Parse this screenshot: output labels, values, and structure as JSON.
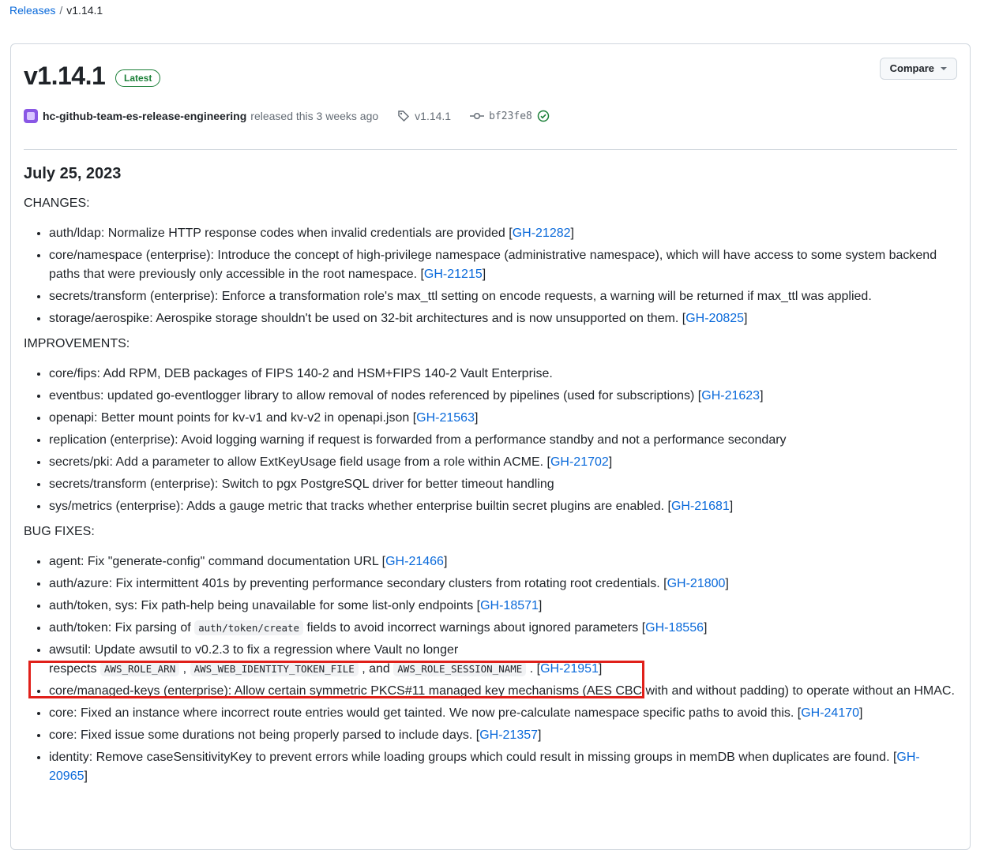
{
  "breadcrumb": {
    "root": "Releases",
    "sep": "/",
    "current": "v1.14.1"
  },
  "release": {
    "title": "v1.14.1",
    "badge": "Latest",
    "compare": "Compare",
    "author": "hc-github-team-es-release-engineering",
    "released": "released this 3 weeks ago",
    "tag": "v1.14.1",
    "commit": "bf23fe8"
  },
  "notes": {
    "date": "July 25, 2023",
    "changes_header": "CHANGES:",
    "changes": [
      {
        "text": "auth/ldap: Normalize HTTP response codes when invalid credentials are provided [",
        "link": "GH-21282",
        "after": "]"
      },
      {
        "text": "core/namespace (enterprise): Introduce the concept of high-privilege namespace (administrative namespace), which will have access to some system backend paths that were previously only accessible in the root namespace. [",
        "link": "GH-21215",
        "after": "]"
      },
      {
        "text": "secrets/transform (enterprise): Enforce a transformation role's max_ttl setting on encode requests, a warning will be returned if max_ttl was applied.",
        "link": "",
        "after": ""
      },
      {
        "text": "storage/aerospike: Aerospike storage shouldn't be used on 32-bit architectures and is now unsupported on them. [",
        "link": "GH-20825",
        "after": "]"
      }
    ],
    "improvements_header": "IMPROVEMENTS:",
    "improvements": [
      {
        "text": "core/fips: Add RPM, DEB packages of FIPS 140-2 and HSM+FIPS 140-2 Vault Enterprise.",
        "link": "",
        "after": ""
      },
      {
        "text": "eventbus: updated go-eventlogger library to allow removal of nodes referenced by pipelines (used for subscriptions) [",
        "link": "GH-21623",
        "after": "]"
      },
      {
        "text": "openapi: Better mount points for kv-v1 and kv-v2 in openapi.json [",
        "link": "GH-21563",
        "after": "]"
      },
      {
        "text": "replication (enterprise): Avoid logging warning if request is forwarded from a performance standby and not a performance secondary",
        "link": "",
        "after": ""
      },
      {
        "text": "secrets/pki: Add a parameter to allow ExtKeyUsage field usage from a role within ACME. [",
        "link": "GH-21702",
        "after": "]"
      },
      {
        "text": "secrets/transform (enterprise): Switch to pgx PostgreSQL driver for better timeout handling",
        "link": "",
        "after": ""
      },
      {
        "text": "sys/metrics (enterprise): Adds a gauge metric that tracks whether enterprise builtin secret plugins are enabled. [",
        "link": "GH-21681",
        "after": "]"
      }
    ],
    "bugfixes_header": "BUG FIXES:",
    "bugfixes": [
      {
        "text": "agent: Fix \"generate-config\" command documentation URL [",
        "link": "GH-21466",
        "after": "]"
      },
      {
        "text": "auth/azure: Fix intermittent 401s by preventing performance secondary clusters from rotating root credentials. [",
        "link": "GH-21800",
        "after": "]"
      },
      {
        "text": "auth/token, sys: Fix path-help being unavailable for some list-only endpoints [",
        "link": "GH-18571",
        "after": "]"
      }
    ],
    "bug_token_create": {
      "before": "auth/token: Fix parsing of ",
      "code": "auth/token/create",
      "middle": " fields to avoid incorrect warnings about ignored parameters [",
      "link": "GH-18556",
      "after": "]"
    },
    "bug_awsutil": {
      "line1": "awsutil: Update awsutil to v0.2.3 to fix a regression where Vault no longer",
      "respects": "respects ",
      "code1": "AWS_ROLE_ARN",
      "comma1": " , ",
      "code2": "AWS_WEB_IDENTITY_TOKEN_FILE",
      "and": " , and ",
      "code3": "AWS_ROLE_SESSION_NAME",
      "dot": " . [",
      "link": "GH-21951",
      "after": "]"
    },
    "bugfixes2": [
      {
        "text": "core/managed-keys (enterprise): Allow certain symmetric PKCS#11 managed key mechanisms (AES CBC with and without padding) to operate without an HMAC.",
        "link": "",
        "after": ""
      },
      {
        "text": "core: Fixed an instance where incorrect route entries would get tainted. We now pre-calculate namespace specific paths to avoid this. [",
        "link": "GH-24170",
        "after": "]"
      },
      {
        "text": "core: Fixed issue some durations not being properly parsed to include days. [",
        "link": "GH-21357",
        "after": "]"
      },
      {
        "text": "identity: Remove caseSensitivityKey to prevent errors while loading groups which could result in missing groups in memDB when duplicates are found. [",
        "link": "GH-20965",
        "after": "]"
      }
    ]
  }
}
